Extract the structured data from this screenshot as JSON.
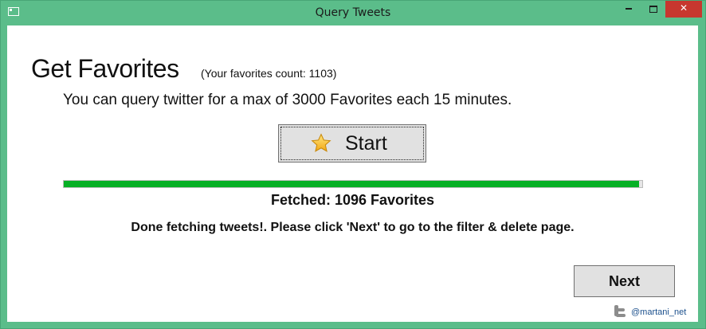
{
  "window": {
    "title": "Query Tweets"
  },
  "controls": {
    "minimize_icon": "minimize-icon",
    "maximize_icon": "maximize-icon",
    "close_icon": "close-icon",
    "close_label": "✕"
  },
  "main": {
    "heading": "Get Favorites",
    "favorites_count": "(Your favorites count: 1103)",
    "info": "You can query twitter for a max of 3000 Favorites each 15 minutes.",
    "start_button": {
      "label": "Start",
      "icon": "star-icon"
    },
    "progress": {
      "value": 1096,
      "max": 1103,
      "fraction": 0.994,
      "color": "#06b025"
    },
    "fetched_text": "Fetched: 1096 Favorites",
    "status_text": "Done fetching tweets!. Please click 'Next' to go to the filter & delete page.",
    "next_button": {
      "label": "Next"
    }
  },
  "footer": {
    "icon": "twitter-icon",
    "handle": "@martani_net"
  },
  "colors": {
    "frame": "#5bbd8a",
    "close": "#c7372f",
    "button": "#e1e1e1"
  }
}
